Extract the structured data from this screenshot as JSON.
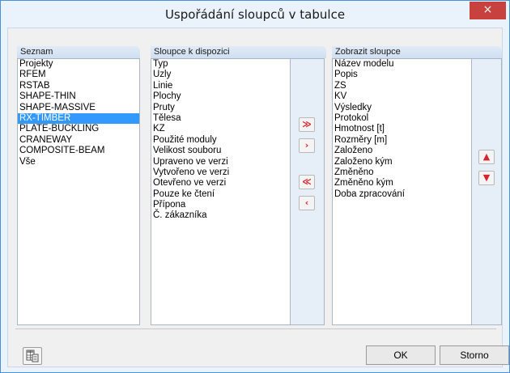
{
  "window": {
    "title": "Uspořádání sloupců v tabulce",
    "close_glyph": "×"
  },
  "seznam": {
    "header": "Seznam",
    "items": [
      "Projekty",
      "RFEM",
      "RSTAB",
      "SHAPE-THIN",
      "SHAPE-MASSIVE",
      "RX-TIMBER",
      "PLATE-BUCKLING",
      "CRANEWAY",
      "COMPOSITE-BEAM",
      "Vše"
    ],
    "selected_item": "RX-TIMBER"
  },
  "available": {
    "header": "Sloupce k dispozici",
    "items": [
      "Typ",
      "Uzly",
      "Linie",
      "Plochy",
      "Pruty",
      "Tělesa",
      "KZ",
      "Použité moduly",
      "Velikost souboru",
      "Upraveno ve verzi",
      "Vytvořeno ve verzi",
      "Otevřeno ve verzi",
      "Pouze ke čtení",
      "Přípona",
      "Č. zákazníka"
    ]
  },
  "move_buttons": {
    "add_all": "≫",
    "add_one": "›",
    "remove_all": "≪",
    "remove_one": "‹"
  },
  "displayed": {
    "header": "Zobrazit sloupce",
    "items": [
      "Název modelu",
      "Popis",
      "ZS",
      "KV",
      "Výsledky",
      "Protokol",
      "Hmotnost [t]",
      "Rozměry [m]",
      "Založeno",
      "Založeno kým",
      "Změněno",
      "Změněno kým",
      "Doba zpracování"
    ]
  },
  "order_buttons": {
    "up": "▲",
    "down": "▼"
  },
  "footer": {
    "ok_label": "OK",
    "cancel_label": "Storno"
  },
  "colors": {
    "accent_red": "#d5262f",
    "selection_blue": "#3399ff",
    "close_red": "#c7413f"
  }
}
